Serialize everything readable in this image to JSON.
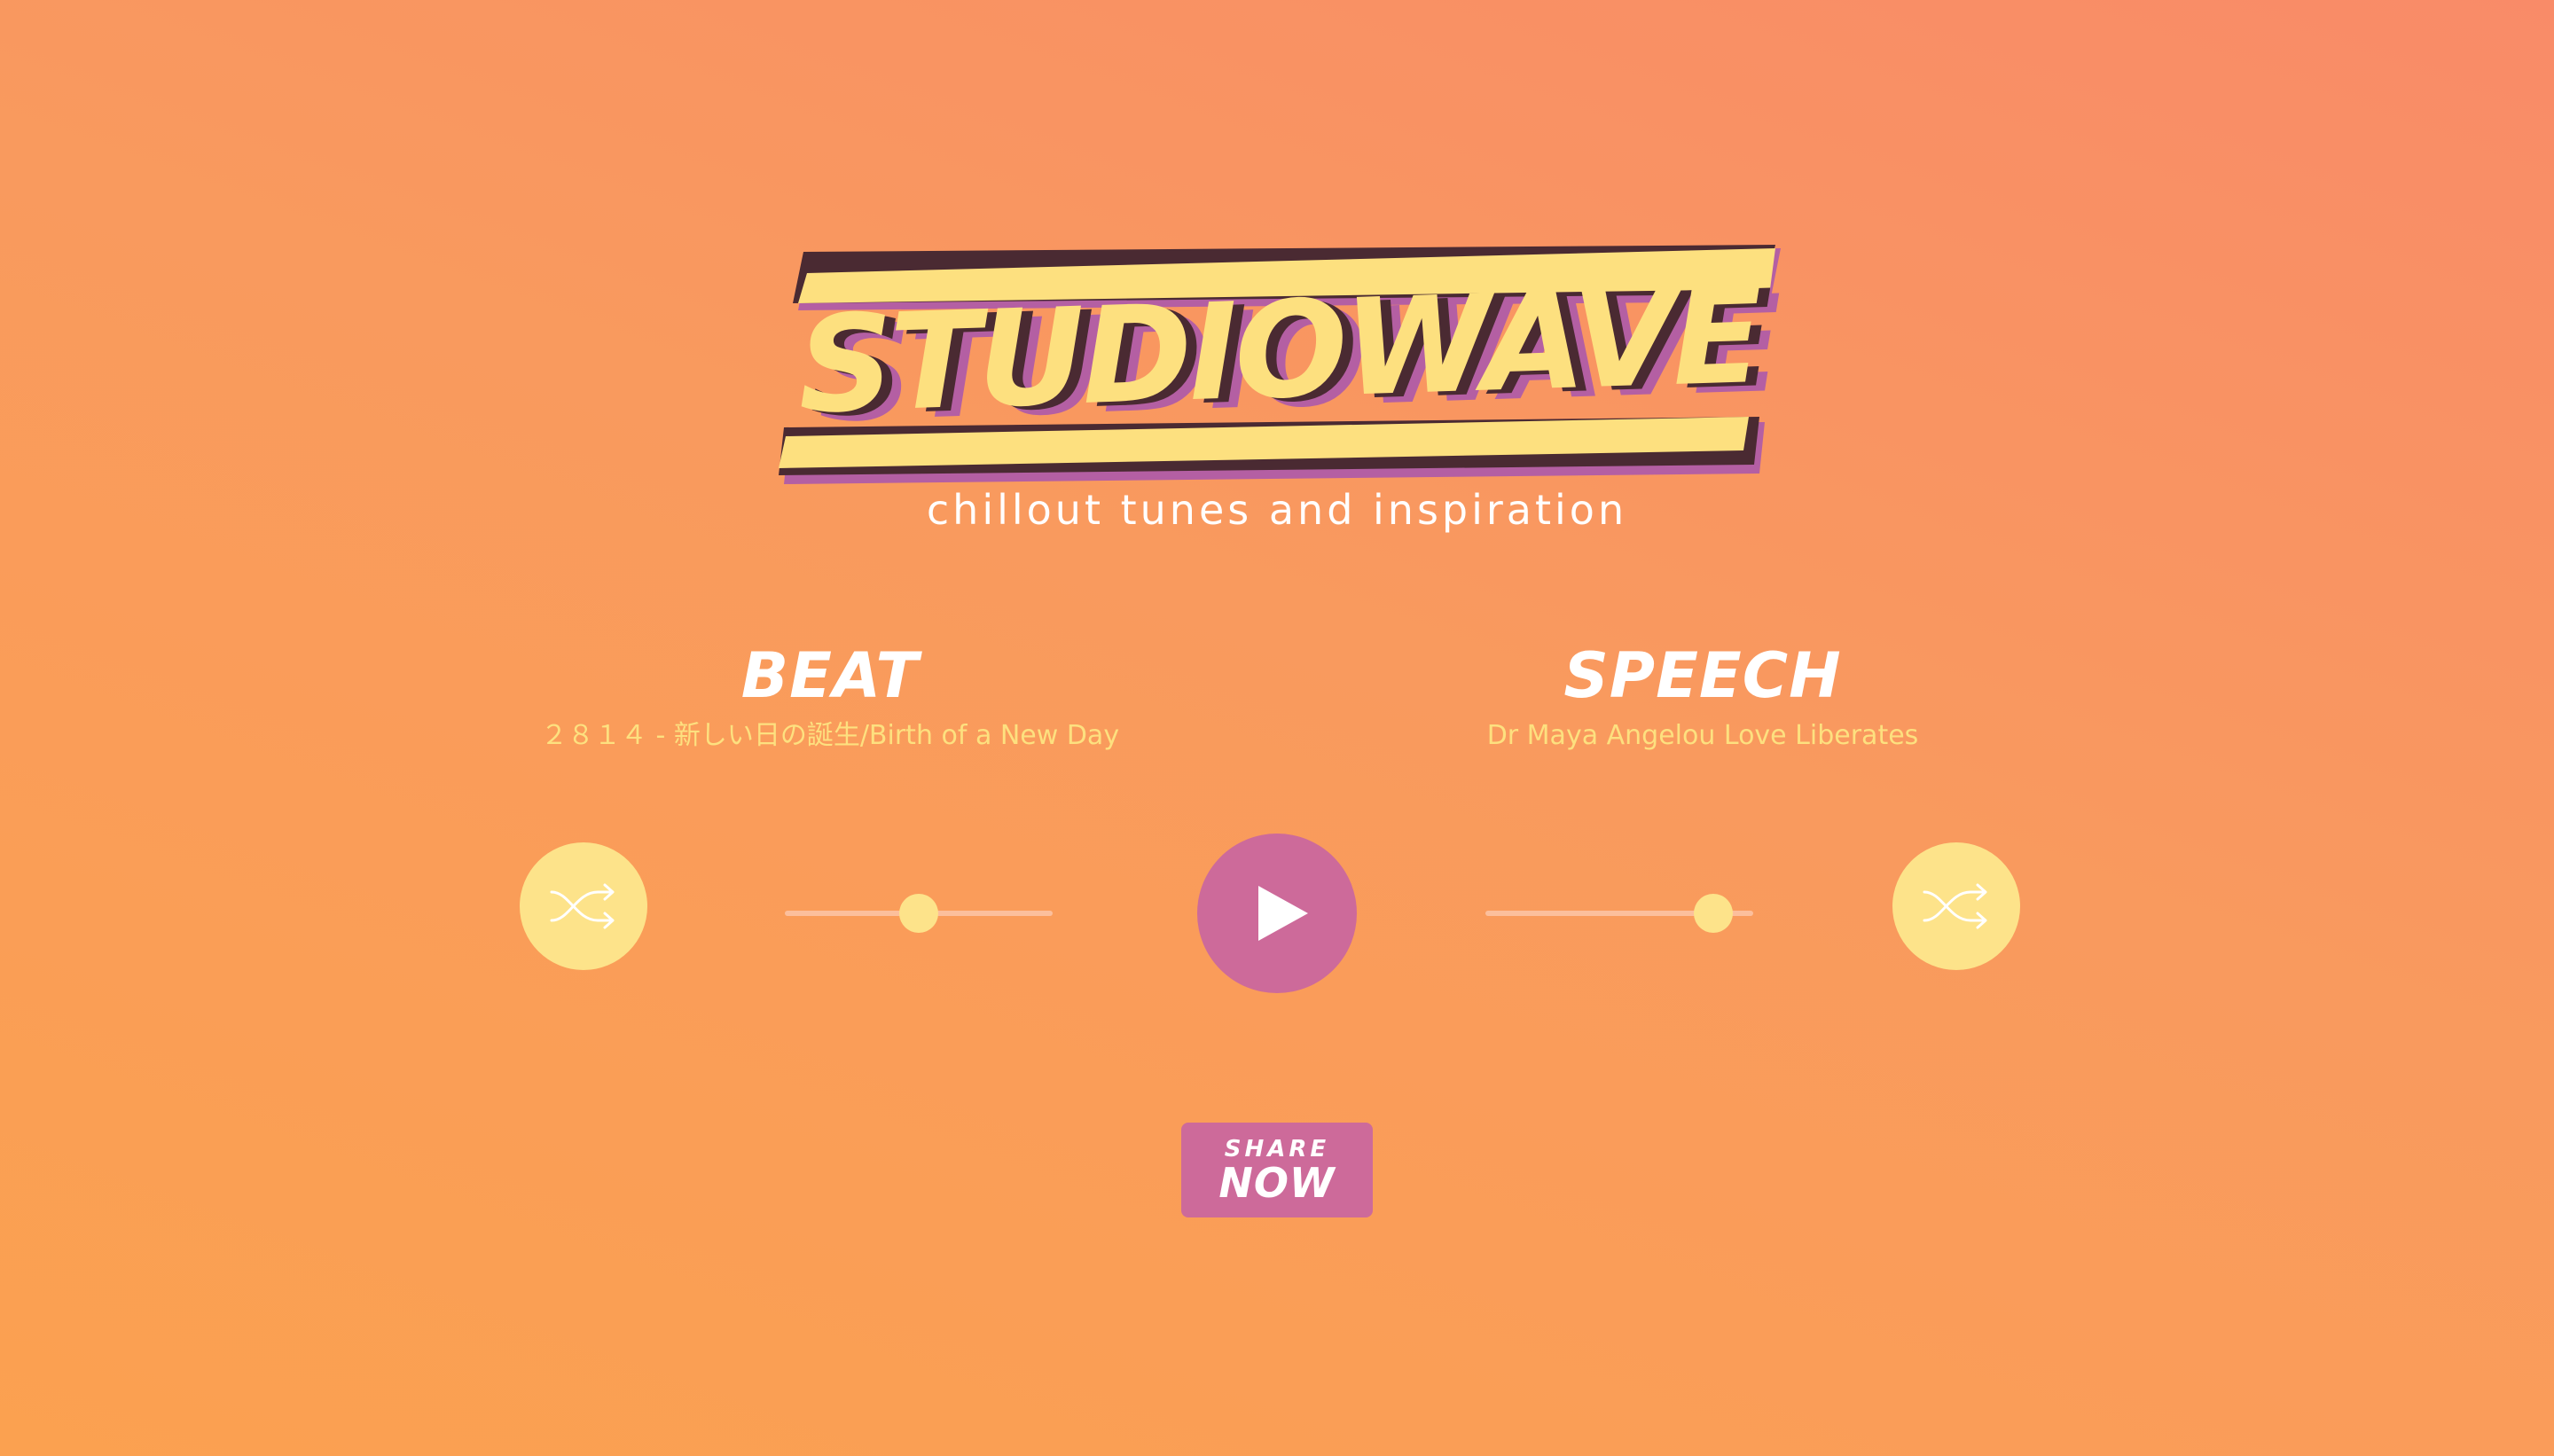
{
  "brand": {
    "logo_text": "STUDIOWAVE",
    "tagline": "chillout tunes and inspiration"
  },
  "channels": {
    "beat": {
      "title": "BEAT",
      "track": "２８１４ - 新しい日の誕生/Birth of a New Day",
      "volume": 0.5
    },
    "speech": {
      "title": "SPEECH",
      "track": "Dr Maya Angelou Love Liberates",
      "volume": 0.85
    }
  },
  "controls": {
    "shuffle_icon": "shuffle-icon",
    "play_icon": "play-icon"
  },
  "share": {
    "line1": "SHARE",
    "line2": "NOW"
  },
  "colors": {
    "background_top": "#f98b68",
    "background_bottom": "#fba150",
    "accent_yellow": "#fde07f",
    "accent_pink": "#cd6a9a",
    "logo_shadow_dark": "#4a2a32",
    "logo_shadow_purple": "#b45fa3"
  }
}
